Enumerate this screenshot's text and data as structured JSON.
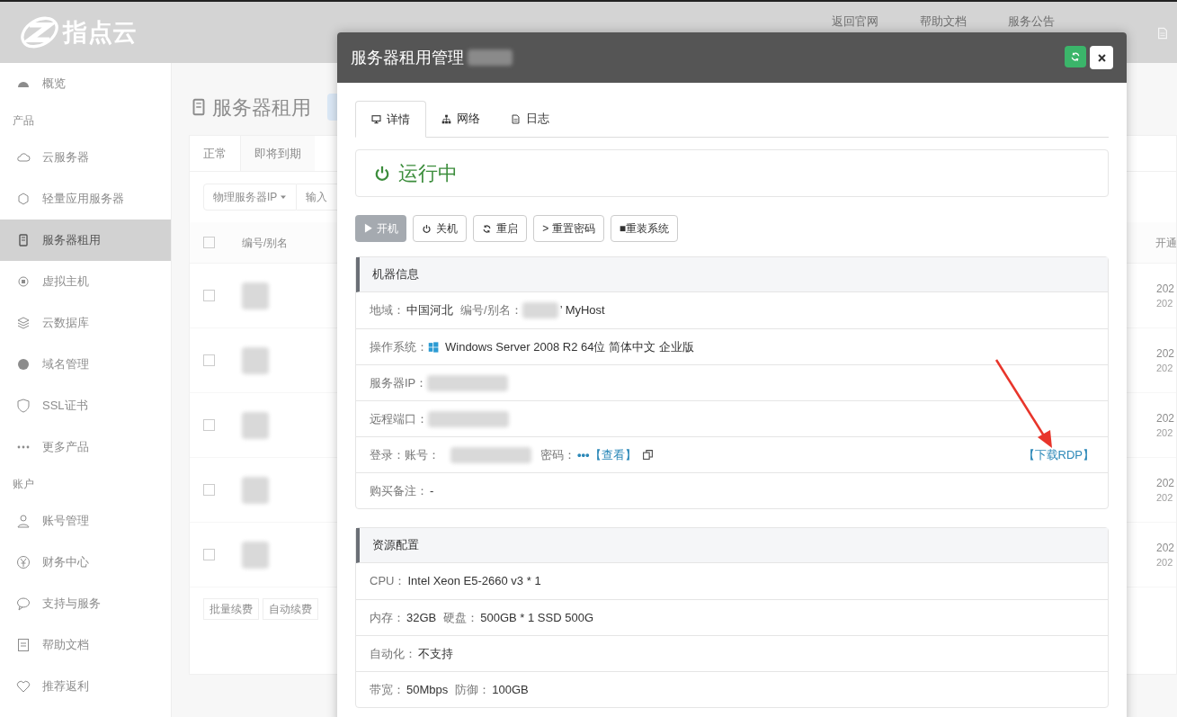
{
  "topbar": {
    "logo_text": "指点云",
    "links": [
      "返回官网",
      "帮助文档",
      "服务公告"
    ]
  },
  "sidebar": {
    "items": [
      {
        "kind": "item",
        "label": "概览",
        "selected": false
      },
      {
        "kind": "section",
        "label": "产品"
      },
      {
        "kind": "item",
        "label": "云服务器",
        "selected": false
      },
      {
        "kind": "item",
        "label": "轻量应用服务器",
        "selected": false
      },
      {
        "kind": "item",
        "label": "服务器租用",
        "selected": true
      },
      {
        "kind": "item",
        "label": "虚拟主机",
        "selected": false
      },
      {
        "kind": "item",
        "label": "云数据库",
        "selected": false
      },
      {
        "kind": "item",
        "label": "域名管理",
        "selected": false
      },
      {
        "kind": "item",
        "label": "SSL证书",
        "selected": false
      },
      {
        "kind": "item",
        "label": "更多产品",
        "selected": false
      },
      {
        "kind": "section",
        "label": "账户"
      },
      {
        "kind": "item",
        "label": "账号管理",
        "selected": false
      },
      {
        "kind": "item",
        "label": "财务中心",
        "selected": false
      },
      {
        "kind": "item",
        "label": "支持与服务",
        "selected": false
      },
      {
        "kind": "item",
        "label": "帮助文档",
        "selected": false
      },
      {
        "kind": "item",
        "label": "推荐返利",
        "selected": false
      }
    ]
  },
  "page": {
    "title": "服务器租用",
    "tabs": [
      {
        "label": "正常",
        "selected": true
      },
      {
        "label": "即将到期",
        "selected": false
      }
    ],
    "filter": {
      "dropdown": "物理服务器IP",
      "placeholder": "输入"
    },
    "table": {
      "columns": [
        "编号/别名",
        "开通"
      ],
      "all_checked": false,
      "rows": [
        {
          "checked": false,
          "date": "202",
          "date_2": "202"
        },
        {
          "checked": false,
          "date": "202",
          "date_2": "202"
        },
        {
          "checked": false,
          "date": "202",
          "date_2": "202"
        },
        {
          "checked": false,
          "date": "202",
          "date_2": "202"
        },
        {
          "checked": false,
          "date": "202",
          "date_2": "202"
        }
      ]
    },
    "footer_buttons": [
      "批量续费",
      "自动续费"
    ]
  },
  "modal": {
    "title": "服务器租用管理",
    "tabs": [
      {
        "label": "详情",
        "selected": true
      },
      {
        "label": "网络",
        "selected": false
      },
      {
        "label": "日志",
        "selected": false
      }
    ],
    "status": "运行中",
    "actions": [
      {
        "label": "▶ 开机",
        "disabled": true
      },
      {
        "label": "关机",
        "disabled": false
      },
      {
        "label": "重启",
        "disabled": false
      },
      {
        "label": "> 重置密码",
        "disabled": false
      },
      {
        "label": "■重装系统",
        "disabled": false
      }
    ],
    "panels": [
      {
        "title": "机器信息",
        "rows": [
          {
            "kind": "fields",
            "fields": [
              {
                "label": "地域：",
                "value": "中国河北",
                "redacted": false
              },
              {
                "label": "编号/别名：",
                "value": "’ MyHost",
                "redacted": true
              }
            ]
          },
          {
            "kind": "os",
            "fields": [
              {
                "label": "操作系统：",
                "value": "Windows Server 2008 R2 64位 简体中文 企业版",
                "redacted": false
              }
            ]
          },
          {
            "kind": "fields",
            "fields": [
              {
                "label": "服务器IP：",
                "redacted": true
              }
            ]
          },
          {
            "kind": "fields",
            "fields": [
              {
                "label": "远程端口：",
                "redacted": true
              }
            ]
          },
          {
            "kind": "login",
            "label": "登录：",
            "account_label": "账号：",
            "password_label": "密码：",
            "password": "•••",
            "view_link": "【查看】",
            "rdp_link": "【下载RDP】"
          },
          {
            "kind": "fields",
            "fields": [
              {
                "label": "购买备注：",
                "value": "-",
                "redacted": false
              }
            ]
          }
        ]
      },
      {
        "title": "资源配置",
        "rows": [
          {
            "kind": "fields",
            "fields": [
              {
                "label": "CPU：",
                "value": "Intel Xeon E5-2660 v3 * 1",
                "redacted": false
              }
            ]
          },
          {
            "kind": "fields",
            "fields": [
              {
                "label": "内存：",
                "value": "32GB",
                "redacted": false
              },
              {
                "label": "硬盘：",
                "value": "500GB * 1 SSD 500G",
                "redacted": false
              }
            ]
          },
          {
            "kind": "fields",
            "fields": [
              {
                "label": "自动化：",
                "value": "不支持",
                "redacted": false
              }
            ]
          },
          {
            "kind": "fields",
            "fields": [
              {
                "label": "带宽：",
                "value": "50Mbps",
                "redacted": false
              },
              {
                "label": "防御：",
                "value": "100GB",
                "redacted": false
              }
            ]
          }
        ]
      }
    ]
  }
}
